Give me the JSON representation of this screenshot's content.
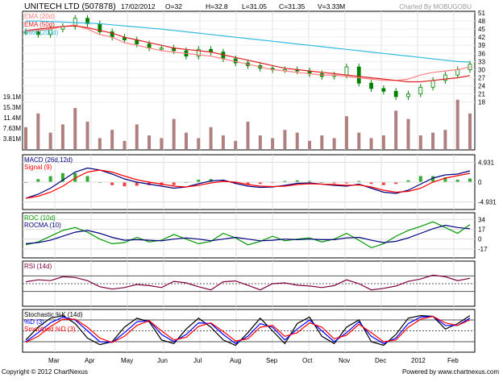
{
  "header": {
    "symbol": "UNITECH LTD (507878)",
    "date": "17/02/2012",
    "open": "O=32",
    "high": "H=32.8",
    "low": "L=31.05",
    "close": "C=31.35",
    "volume": "V=3.33M",
    "credit": "Charted By MOBUGOBU"
  },
  "footer": {
    "copyright": "Copyright © 2012 ChartNexus",
    "powered": "Powered by www.chartnexus.com"
  },
  "colors": {
    "bg": "#ffffff",
    "frame": "#000000",
    "candle": "#008000",
    "ema20": "#ff8080",
    "ema50": "#dd2222",
    "ema200": "#33bbdd",
    "macd": "#000080",
    "signal": "#ff0000",
    "roc": "#009900",
    "rocma": "#000080",
    "rsi": "#800040",
    "stochK": "#000000",
    "stochD": "#0000ff",
    "stochSmooth": "#ff0000",
    "volume": "#b08080"
  },
  "x_labels": [
    "Mar",
    "Apr",
    "May",
    "Jun",
    "Jul",
    "Aug",
    "Sep",
    "Oct",
    "Nov",
    "Dec",
    "2012",
    "Feb"
  ],
  "chart_data": [
    {
      "type": "line",
      "panel": "price",
      "series": [
        {
          "name": "EMA (20d)",
          "color": "#ff8080",
          "values": [
            44,
            44.5,
            45,
            46,
            46.5,
            45,
            43,
            42,
            40,
            39,
            38,
            37,
            36.5,
            36,
            35.5,
            35,
            34,
            33,
            32,
            31,
            30,
            29.5,
            29,
            28.5,
            28,
            28,
            27.5,
            27,
            26.5,
            26,
            26,
            26.5,
            28,
            29,
            29.5,
            30,
            31
          ]
        },
        {
          "name": "EMA (50d)",
          "color": "#dd2222",
          "values": [
            44.5,
            45,
            45.5,
            46,
            46.2,
            45.5,
            44.5,
            43.5,
            42,
            41,
            40,
            39,
            38,
            37.5,
            37,
            36.5,
            35.5,
            34.5,
            33.5,
            32.5,
            31.5,
            30.5,
            30,
            29.5,
            29,
            28.5,
            28,
            27.5,
            27,
            26.5,
            26,
            25.5,
            25.5,
            26,
            26.5,
            27,
            27.8
          ]
        },
        {
          "name": "EMA (200d)",
          "color": "#33bbdd",
          "values": [
            48,
            48,
            47.8,
            47.6,
            47.4,
            47.2,
            47,
            46.6,
            46.2,
            45.8,
            45.4,
            45,
            44.5,
            44,
            43.5,
            43,
            42.5,
            42,
            41.5,
            41,
            40.5,
            40,
            39.5,
            39,
            38.5,
            38,
            37.5,
            37,
            36.5,
            36,
            35.5,
            35,
            34.5,
            34,
            33.5,
            33,
            32.8
          ]
        },
        {
          "name": "price",
          "color": "#008000",
          "values": [
            44,
            43,
            45,
            46,
            49,
            47,
            44,
            42,
            41,
            39.5,
            38,
            38,
            37,
            35,
            37.5,
            36.5,
            34,
            32.5,
            31.5,
            30.5,
            30,
            30,
            29.5,
            28.5,
            27.5,
            28,
            31,
            25,
            23,
            22,
            20,
            21,
            23.5,
            26,
            28,
            30,
            32
          ]
        }
      ],
      "y_ticks": [
        "51",
        "48",
        "45",
        "42",
        "39",
        "36",
        "33",
        "30",
        "27",
        "24",
        "21",
        "18"
      ],
      "ylim": [
        17,
        51
      ]
    },
    {
      "type": "bar",
      "panel": "volume",
      "y_ticks": [
        "19.1M",
        "15.3M",
        "11.4M",
        "7.63M",
        "3.81M"
      ],
      "values": [
        8,
        13,
        6,
        9,
        15,
        10,
        4,
        7,
        3,
        9,
        5,
        4,
        11,
        6,
        4,
        8,
        5,
        3,
        10,
        5,
        4,
        7,
        6,
        3,
        5,
        4,
        12,
        6,
        4,
        5,
        14,
        11,
        5,
        6,
        7,
        18,
        13
      ]
    },
    {
      "type": "line",
      "panel": "macd",
      "series": [
        {
          "name": "MACD (26d,12d)",
          "color": "#000080",
          "values": [
            -4,
            -3,
            -1.5,
            0.5,
            2.5,
            3.5,
            3,
            2,
            0.8,
            0,
            -0.5,
            -1,
            -1.5,
            -1.2,
            -0.4,
            0.3,
            0.5,
            -0.3,
            -1,
            -1.3,
            -1.2,
            -0.8,
            -0.3,
            -0.2,
            -0.5,
            -0.8,
            -1,
            -0.5,
            -1.5,
            -2.5,
            -2.8,
            -2,
            -0.5,
            1,
            1.8,
            2,
            2.8
          ]
        },
        {
          "name": "Signal (9)",
          "color": "#ff0000",
          "values": [
            -4,
            -3.5,
            -2.5,
            -1,
            1,
            2.5,
            3,
            2.5,
            1.5,
            0.6,
            0,
            -0.5,
            -1,
            -1.2,
            -0.8,
            -0.2,
            0.2,
            0,
            -0.6,
            -1,
            -1.1,
            -1,
            -0.6,
            -0.4,
            -0.5,
            -0.6,
            -0.8,
            -0.7,
            -1.2,
            -2,
            -2.5,
            -2.3,
            -1.5,
            0,
            1,
            1.6,
            2.2
          ]
        }
      ],
      "y_ticks": [
        "4.931",
        "0",
        "-4.931"
      ],
      "ylim": [
        -6,
        6
      ]
    },
    {
      "type": "line",
      "panel": "roc",
      "series": [
        {
          "name": "ROC (10d)",
          "color": "#009900",
          "values": [
            -10,
            -5,
            5,
            15,
            20,
            12,
            0,
            -8,
            -6,
            3,
            -5,
            -2,
            8,
            0,
            -8,
            -4,
            10,
            2,
            -10,
            -4,
            5,
            -3,
            0,
            2,
            -5,
            0,
            10,
            -2,
            -15,
            -8,
            5,
            15,
            22,
            30,
            20,
            10,
            25
          ]
        },
        {
          "name": "ROCMA (10)",
          "color": "#000080",
          "values": [
            -8,
            -6,
            -2,
            5,
            12,
            15,
            10,
            3,
            -2,
            -1,
            -2,
            -3,
            0,
            2,
            0,
            -3,
            0,
            3,
            0,
            -3,
            -2,
            0,
            -1,
            0,
            -1,
            -1,
            2,
            3,
            -2,
            -6,
            -4,
            2,
            10,
            18,
            24,
            20,
            18
          ]
        }
      ],
      "y_ticks": [
        "34",
        "17",
        "0",
        "-17"
      ],
      "ylim": [
        -27,
        40
      ]
    },
    {
      "type": "line",
      "panel": "rsi",
      "series": [
        {
          "name": "RSI (14d)",
          "color": "#800040",
          "values": [
            55,
            60,
            58,
            68,
            66,
            58,
            42,
            36,
            40,
            48,
            45,
            40,
            56,
            52,
            42,
            34,
            55,
            57,
            46,
            34,
            50,
            52,
            46,
            44,
            40,
            45,
            60,
            50,
            34,
            38,
            44,
            56,
            62,
            72,
            68,
            58,
            64
          ]
        }
      ],
      "levels": [
        30,
        50,
        70
      ],
      "ylim": [
        0,
        100
      ]
    },
    {
      "type": "line",
      "panel": "stochastic",
      "series": [
        {
          "name": "Stochastic %K (14d)",
          "color": "#000000",
          "values": [
            25,
            60,
            85,
            92,
            70,
            30,
            12,
            20,
            60,
            85,
            75,
            25,
            15,
            55,
            85,
            60,
            25,
            10,
            45,
            85,
            50,
            15,
            70,
            88,
            35,
            15,
            60,
            80,
            20,
            10,
            40,
            85,
            92,
            90,
            55,
            70,
            92
          ]
        },
        {
          "name": "%D (3)",
          "color": "#0000ff",
          "values": [
            20,
            45,
            72,
            88,
            80,
            50,
            20,
            18,
            45,
            75,
            78,
            40,
            20,
            40,
            72,
            70,
            40,
            15,
            35,
            70,
            60,
            25,
            55,
            80,
            50,
            20,
            45,
            75,
            35,
            15,
            30,
            70,
            88,
            90,
            65,
            65,
            85
          ]
        },
        {
          "name": "Smoothed %D (3)",
          "color": "#ff0000",
          "values": [
            18,
            35,
            62,
            82,
            82,
            60,
            30,
            18,
            35,
            65,
            78,
            50,
            25,
            32,
            62,
            72,
            48,
            22,
            28,
            60,
            65,
            35,
            45,
            72,
            60,
            28,
            38,
            68,
            45,
            20,
            25,
            60,
            82,
            90,
            72,
            65,
            80
          ]
        }
      ],
      "levels": [
        20,
        50,
        80
      ],
      "ylim": [
        0,
        100
      ]
    }
  ]
}
